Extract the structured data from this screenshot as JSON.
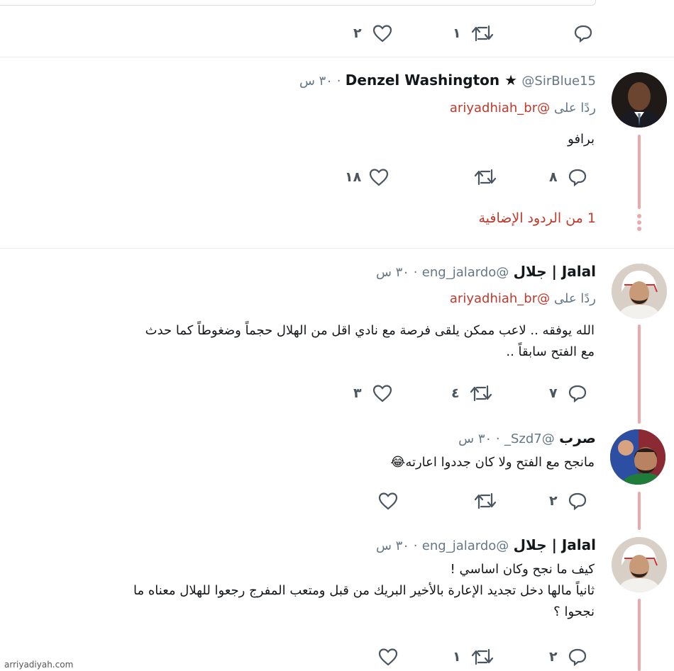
{
  "top": {
    "like_count": "٢",
    "retweet_count": "١"
  },
  "tweets": [
    {
      "name": "Denzel Washington ★",
      "handle": "@SirBlue15",
      "time": "٣٠ س",
      "reply_label": "ردًا على",
      "reply_handle": "@ariyadhiah_br",
      "text_lines": [
        "برافو"
      ],
      "reply_count": "٨",
      "retweet_count": "",
      "like_count": "١٨",
      "more_replies": "1 من الردود الإضافية"
    },
    {
      "name": "Jalal | جلال",
      "handle": "@eng_jalardo",
      "time": "٣٠ س",
      "reply_label": "ردًا على",
      "reply_handle": "@ariyadhiah_br",
      "text_lines": [
        "الله يوفقه .. لاعب ممكن يلقى فرصة مع نادي اقل من الهلال حجماً وضغوطاً كما حدث",
        "مع الفتح سابقاً .."
      ],
      "reply_count": "٧",
      "retweet_count": "٤",
      "like_count": "٣"
    },
    {
      "name": "صرب",
      "handle": "@Szd7_",
      "time": "٣٠ س",
      "text_lines": [
        "مانجح مع الفتح ولا كان جددوا اعارته"
      ],
      "emoji": "😂",
      "reply_count": "٢",
      "retweet_count": "",
      "like_count": ""
    },
    {
      "name": "Jalal | جلال",
      "handle": "@eng_jalardo",
      "time": "٣٠ س",
      "text_lines": [
        "كيف ما نجح وكان اساسي !",
        "ثانياً مالها دخل تجديد الإعارة بالأخير البريك من قبل ومتعب المفرج رجعوا للهلال معناه ما",
        "نجحوا ؟"
      ],
      "reply_count": "٢",
      "retweet_count": "١",
      "like_count": ""
    }
  ],
  "icons": {
    "reply": "reply-bubble-icon",
    "retweet": "retweet-icon",
    "like": "heart-icon"
  },
  "colors": {
    "accent": "#c0392b",
    "thread": "#eba9ad",
    "icon": "#4b5560"
  },
  "watermark": "arriyadiyah.com"
}
